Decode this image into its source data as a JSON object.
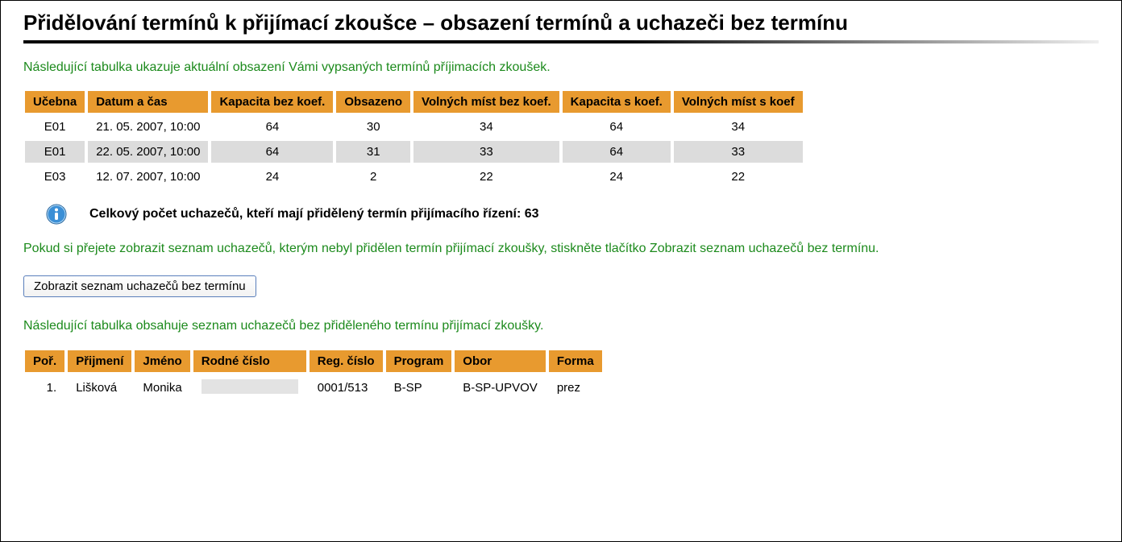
{
  "page": {
    "title": "Přidělování termínů k přijímací zkoušce – obsazení termínů a uchazeči bez termínu",
    "intro1": "Následující tabulka ukazuje aktuální obsazení Vámi vypsaných termínů příjimacích zkoušek.",
    "intro2": "Pokud si přejete zobrazit seznam uchazečů, kterým nebyl přidělen termín přijímací zkoušky, stiskněte tlačítko Zobrazit seznam uchazečů bez termínu.",
    "intro3": "Následující tabulka obsahuje seznam uchazečů bez přiděleného termínu přijímací zkoušky."
  },
  "capacityTable": {
    "headers": {
      "ucebna": "Učebna",
      "datum": "Datum a čas",
      "kap_bez": "Kapacita bez koef.",
      "obsazeno": "Obsazeno",
      "vol_bez": "Volných míst bez koef.",
      "kap_s": "Kapacita s koef.",
      "vol_s": "Volných míst s koef"
    },
    "rows": [
      {
        "ucebna": "E01",
        "datum": "21. 05. 2007, 10:00",
        "kap_bez": "64",
        "obsazeno": "30",
        "vol_bez": "34",
        "kap_s": "64",
        "vol_s": "34"
      },
      {
        "ucebna": "E01",
        "datum": "22. 05. 2007, 10:00",
        "kap_bez": "64",
        "obsazeno": "31",
        "vol_bez": "33",
        "kap_s": "64",
        "vol_s": "33"
      },
      {
        "ucebna": "E03",
        "datum": "12. 07. 2007, 10:00",
        "kap_bez": "24",
        "obsazeno": "2",
        "vol_bez": "22",
        "kap_s": "24",
        "vol_s": "22"
      }
    ]
  },
  "info": {
    "text": "Celkový počet uchazečů, kteří mají přidělený termín přijímacího řízení: 63"
  },
  "button": {
    "show_list": "Zobrazit seznam uchazečů bez termínu"
  },
  "applicantsTable": {
    "headers": {
      "por": "Poř.",
      "prijmeni": "Přijmení",
      "jmeno": "Jméno",
      "rc": "Rodné číslo",
      "reg": "Reg. číslo",
      "program": "Program",
      "obor": "Obor",
      "forma": "Forma"
    },
    "rows": [
      {
        "por": "1.",
        "prijmeni": "Lišková",
        "jmeno": "Monika",
        "rc": "",
        "reg": "0001/513",
        "program": "B-SP",
        "obor": "B-SP-UPVOV",
        "forma": "prez"
      }
    ]
  }
}
